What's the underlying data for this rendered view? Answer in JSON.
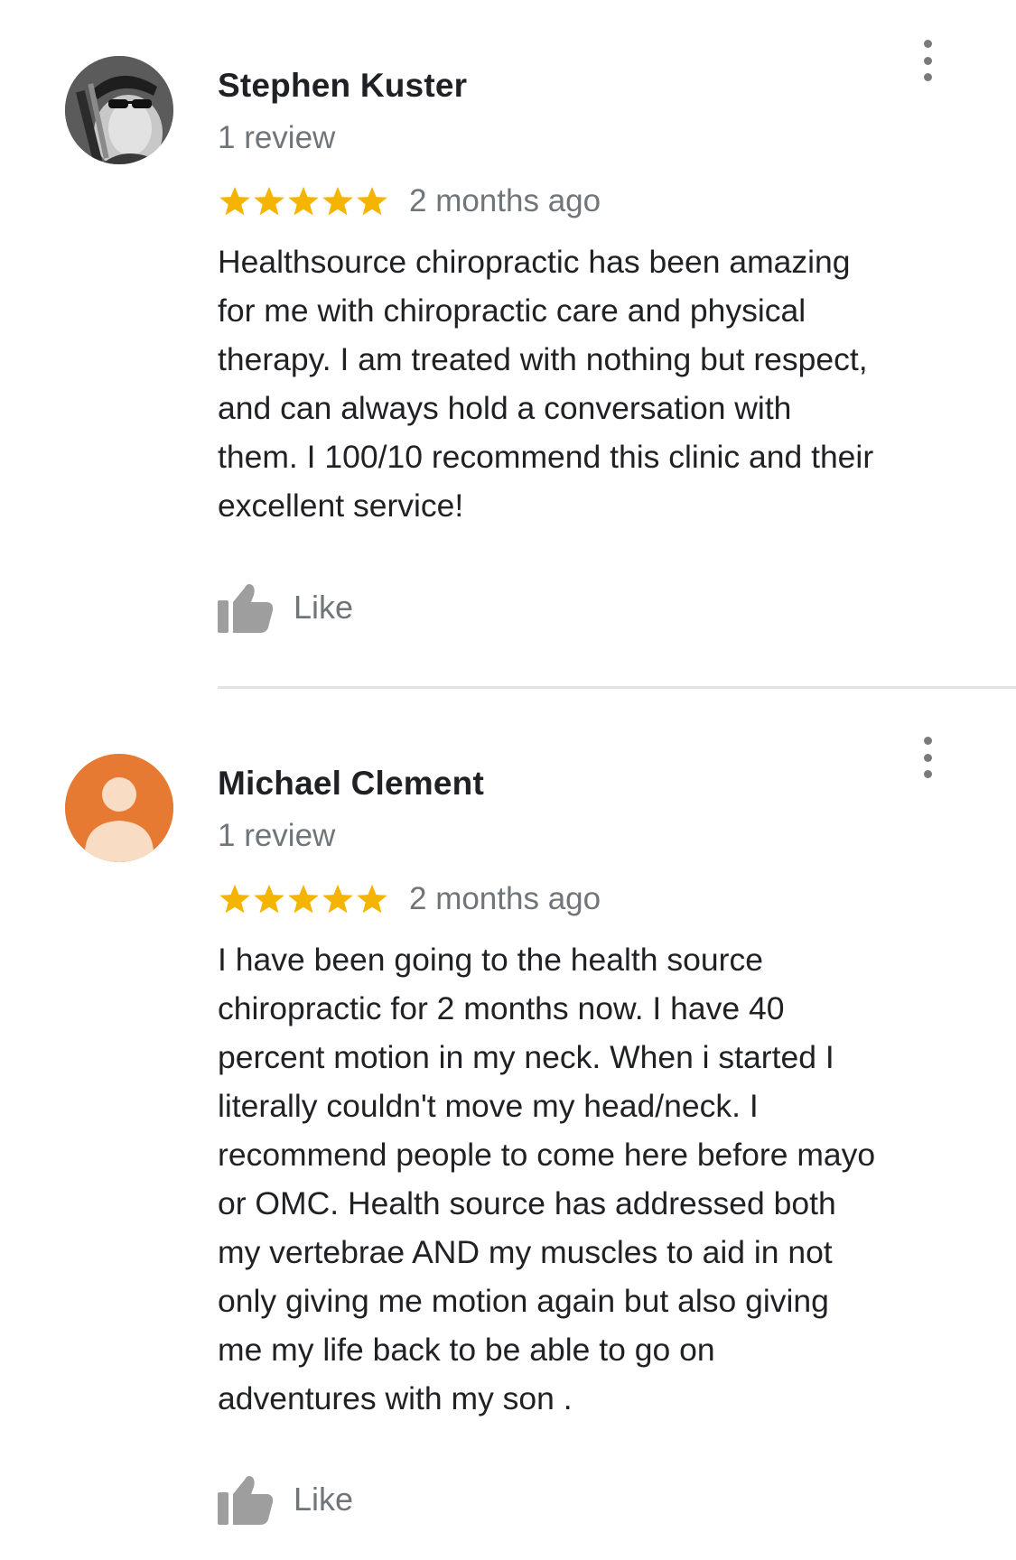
{
  "reviews": [
    {
      "author": "Stephen Kuster",
      "review_count": "1 review",
      "rating": 5,
      "time": "2 months ago",
      "text": "Healthsource chiropractic has been amazing\nfor me with chiropractic care and physical\ntherapy. I am treated with nothing but respect,\nand can always hold a conversation with\nthem. I 100/10 recommend this clinic and their\nexcellent service!",
      "like_label": "Like",
      "avatar_icon": "user-photo"
    },
    {
      "author": "Michael Clement",
      "review_count": "1 review",
      "rating": 5,
      "time": "2 months ago",
      "text": "I have been going to the health source\nchiropractic for 2 months now. I have 40\npercent motion in my neck. When i started I\nliterally couldn't move my head/neck. I\nrecommend people to come here before mayo\nor OMC. Health source has addressed both\nmy vertebrae AND my muscles to aid in not\nonly giving me motion again but also giving\nme my life back to be able to go on\nadventures with my son .",
      "like_label": "Like",
      "avatar_icon": "default-user-avatar"
    }
  ],
  "colors": {
    "star": "#f4b400",
    "secondary_text": "#70757a",
    "primary_text": "#202124",
    "default_avatar_bg": "#e67a32",
    "default_avatar_fg": "#f9dcc4",
    "icon_gray": "#9e9e9e",
    "divider": "#e3e3e3"
  },
  "icons": {
    "menu": "more-vert-icon",
    "star": "star-icon",
    "like": "thumbs-up-icon"
  }
}
